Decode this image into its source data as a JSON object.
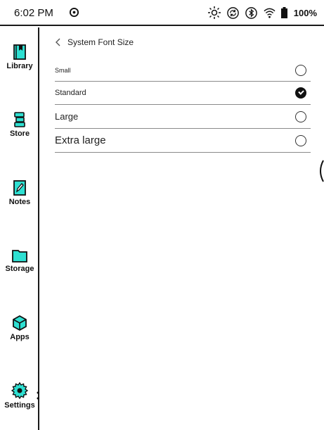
{
  "status_bar": {
    "time": "6:02 PM",
    "battery": "100%",
    "icons": [
      "sync-icon",
      "frontlight-icon",
      "refresh-icon",
      "bluetooth-icon",
      "wifi-icon",
      "battery-icon"
    ]
  },
  "sidebar": {
    "items": [
      {
        "label": "Library",
        "icon": "library-icon"
      },
      {
        "label": "Store",
        "icon": "store-icon"
      },
      {
        "label": "Notes",
        "icon": "notes-icon"
      },
      {
        "label": "Storage",
        "icon": "storage-icon"
      },
      {
        "label": "Apps",
        "icon": "apps-icon"
      },
      {
        "label": "Settings",
        "icon": "settings-icon",
        "active": true
      }
    ],
    "accent_color": "#2ee0d2"
  },
  "page": {
    "title": "System Font Size",
    "options": [
      {
        "label": "Small",
        "selected": false
      },
      {
        "label": "Standard",
        "selected": true
      },
      {
        "label": "Large",
        "selected": false
      },
      {
        "label": "Extra large",
        "selected": false
      }
    ]
  }
}
